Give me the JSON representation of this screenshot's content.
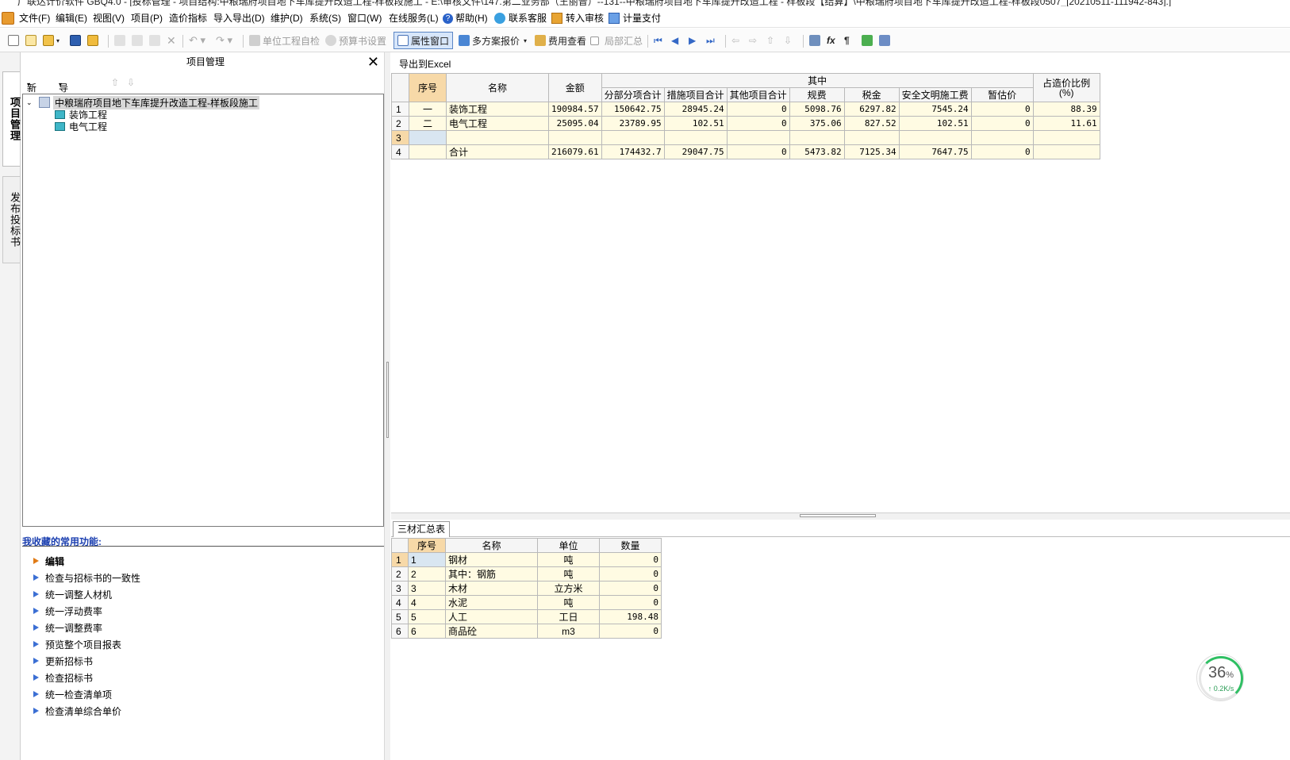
{
  "window": {
    "title": "广联达计价软件 GBQ4.0 - [投标管理 - 项目结构:中粮瑞府项目地下车库提升改造工程-样板段施工 - E:\\审核文件\\147.第二业务部（王丽普）--131--中粮瑞府项目地下车库提升改造工程 - 样板段【结算】\\中粮瑞府项目地下车库提升改造工程-样板段0507_[20210511-111942-843].]"
  },
  "menu": [
    "文件(F)",
    "编辑(E)",
    "视图(V)",
    "项目(P)",
    "造价指标",
    "导入导出(D)",
    "维护(D)",
    "系统(S)",
    "窗口(W)",
    "在线服务(L)",
    "帮助(H)",
    "联系客服",
    "转入审核",
    "计量支付"
  ],
  "toolbar": {
    "unit_check": "单位工程自检",
    "budget_settings": "预算书设置",
    "property_window": "属性窗口",
    "multi_quote": "多方案报价",
    "fee_view": "费用查看",
    "partial_summary": "局部汇总"
  },
  "side_tabs": {
    "project": "项目管理",
    "publish": "发布投标书"
  },
  "project_panel": {
    "title": "项目管理",
    "close": "✕",
    "new_label": "新建",
    "import_export_label": "导入导出",
    "tree": {
      "root": "中粮瑞府项目地下车库提升改造工程-样板段施工",
      "children": [
        "装饰工程",
        "电气工程"
      ]
    }
  },
  "favorites": {
    "title": "我收藏的常用功能:",
    "items": [
      "编辑",
      "检查与招标书的一致性",
      "统一调整人材机",
      "统一浮动费率",
      "统一调整费率",
      "预览整个项目报表",
      "更新招标书",
      "检查招标书",
      "统一检查清单项",
      "检查清单综合单价"
    ]
  },
  "export_excel": "导出到Excel",
  "summary": {
    "group_header": "其中",
    "headers": [
      "序号",
      "名称",
      "金额",
      "分部分项合计",
      "措施项目合计",
      "其他项目合计",
      "规费",
      "税金",
      "安全文明施工费",
      "暂估价",
      "占造价比例(%)"
    ],
    "rows": [
      [
        "1",
        "一",
        "装饰工程",
        "190984.57",
        "150642.75",
        "28945.24",
        "0",
        "5098.76",
        "6297.82",
        "7545.24",
        "0",
        "88.39"
      ],
      [
        "2",
        "二",
        "电气工程",
        "25095.04",
        "23789.95",
        "102.51",
        "0",
        "375.06",
        "827.52",
        "102.51",
        "0",
        "11.61"
      ],
      [
        "3",
        "",
        "",
        "",
        "",
        "",
        "",
        "",
        "",
        "",
        "",
        ""
      ],
      [
        "4",
        "",
        "合计",
        "216079.61",
        "174432.7",
        "29047.75",
        "0",
        "5473.82",
        "7125.34",
        "7647.75",
        "0",
        ""
      ]
    ]
  },
  "lower_tab": "三材汇总表",
  "materials": {
    "headers": [
      "序号",
      "名称",
      "单位",
      "数量"
    ],
    "rows": [
      [
        "1",
        "1",
        "钢材",
        "吨",
        "0"
      ],
      [
        "2",
        "2",
        "其中：钢筋",
        "吨",
        "0"
      ],
      [
        "3",
        "3",
        "木材",
        "立方米",
        "0"
      ],
      [
        "4",
        "4",
        "水泥",
        "吨",
        "0"
      ],
      [
        "5",
        "5",
        "人工",
        "工日",
        "198.48"
      ],
      [
        "6",
        "6",
        "商品砼",
        "m3",
        "0"
      ]
    ]
  },
  "speed_widget": {
    "percent": "36",
    "percent_unit": "%",
    "rate": "↑ 0.2K/s"
  },
  "colors": {
    "header_highlight": "#f7d9a8",
    "data_cell": "#fffbe3",
    "favorites_title": "#1b3fb0",
    "speed_ring": "#2fbf63"
  }
}
